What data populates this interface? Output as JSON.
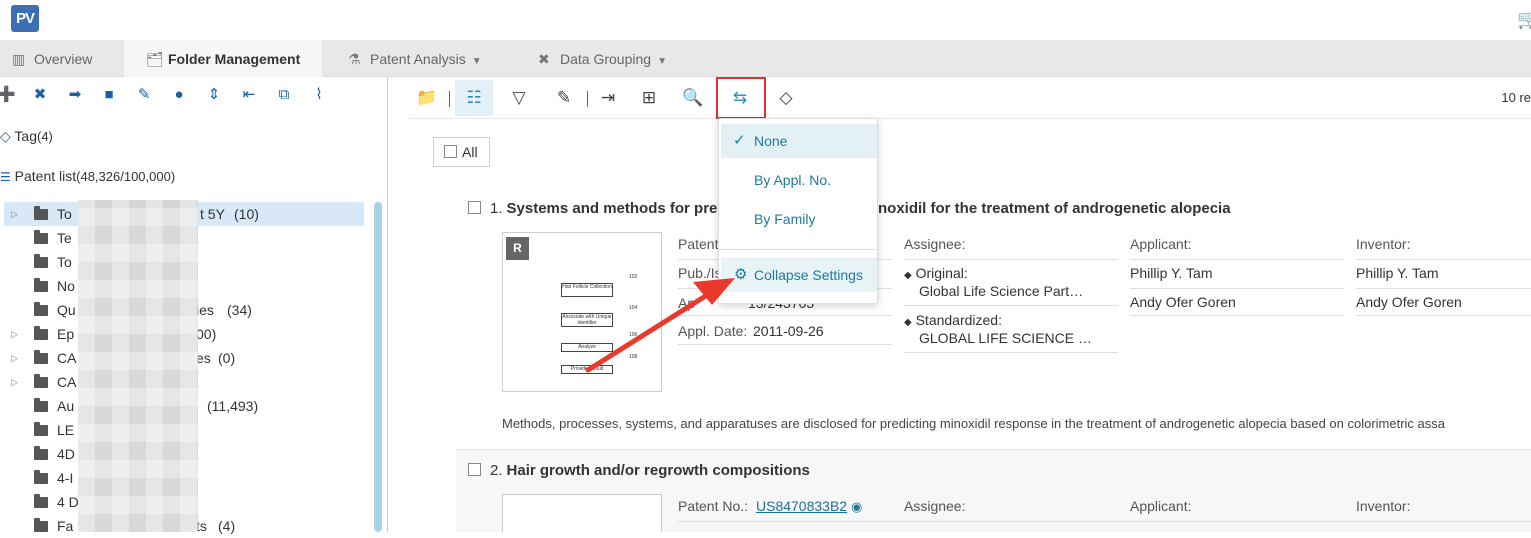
{
  "app": {
    "logo_text": "PV"
  },
  "tabs": [
    {
      "label": "Overview",
      "icon": "overview-icon"
    },
    {
      "label": "Folder Management",
      "icon": "folder-icon"
    },
    {
      "label": "Patent Analysis",
      "icon": "analysis-icon"
    },
    {
      "label": "Data Grouping",
      "icon": "grouping-icon"
    }
  ],
  "sidebar": {
    "tag_label": "Tag",
    "tag_count": "(4)",
    "patent_list_label": "Patent list",
    "patent_list_count": "(48,326/100,000)",
    "folders": [
      {
        "name": "To",
        "suffix": "t 5Y",
        "count": "(10)"
      },
      {
        "name": "Te",
        "suffix": "",
        "count": ""
      },
      {
        "name": "To",
        "suffix": "",
        "count": ""
      },
      {
        "name": "No",
        "suffix": "",
        "count": ""
      },
      {
        "name": "Qu",
        "suffix": "ies",
        "count": "(34)"
      },
      {
        "name": "Ep",
        "suffix": "00)",
        "count": ""
      },
      {
        "name": "CA",
        "suffix": "es",
        "count": "(0)"
      },
      {
        "name": "CA",
        "suffix": "",
        "count": ""
      },
      {
        "name": "Au",
        "suffix": "",
        "count": "(11,493)"
      },
      {
        "name": "LE",
        "suffix": "",
        "count": ""
      },
      {
        "name": "4D",
        "suffix": "",
        "count": ""
      },
      {
        "name": "4-I",
        "suffix": "",
        "count": ""
      },
      {
        "name": "4 D",
        "suffix": "",
        "count": ""
      },
      {
        "name": "Fa",
        "suffix": "ts",
        "count": "(4)"
      }
    ]
  },
  "toolbar": {
    "count_text": "10 re"
  },
  "all_label": "All",
  "results": [
    {
      "num": "1.",
      "title_a": "Systems and methods for pred",
      "title_b": "noxidil for the treatment of androgenetic alopecia",
      "badge": "R",
      "patent_no_label": "Patent",
      "pub_label": "Pub./Is",
      "appl_no_label": "Ap",
      "appl_no_value": "13/243703",
      "appl_date_label": "Appl. Date:",
      "appl_date_value": "2011-09-26",
      "assignee_label": "Assignee:",
      "original_label": "Original:",
      "original_value": "Global Life Science Part…",
      "standardized_label": "Standardized:",
      "standardized_value": "GLOBAL LIFE SCIENCE …",
      "applicant_label": "Applicant:",
      "applicants": [
        "Phillip Y. Tam",
        "Andy Ofer Goren"
      ],
      "inventor_label": "Inventor:",
      "inventors": [
        "Phillip Y. Tam",
        "Andy Ofer Goren"
      ],
      "abstract": "Methods, processes, systems, and apparatuses are disclosed for predicting minoxidil response in the treatment of androgenetic alopecia based on colorimetric assa",
      "figure_boxes": [
        "Hair Follicle Collection",
        "Associate with Unique Identifier",
        "Analyze",
        "Provide Result"
      ],
      "figure_refs": [
        "102",
        "104",
        "106",
        "108"
      ]
    },
    {
      "num": "2.",
      "title": "Hair growth and/or regrowth compositions",
      "patent_no_label": "Patent No.:",
      "patent_no_value": "US8470833B2",
      "assignee_label": "Assignee:",
      "applicant_label": "Applicant:",
      "inventor_label": "Inventor:"
    }
  ],
  "dropdown": {
    "items": [
      "None",
      "By Appl. No.",
      "By Family"
    ],
    "selected": "None",
    "collapse_settings": "Collapse Settings"
  },
  "colors": {
    "accent": "#1f7a9c",
    "highlight": "#e2312a",
    "brand": "#3d6fb4"
  }
}
